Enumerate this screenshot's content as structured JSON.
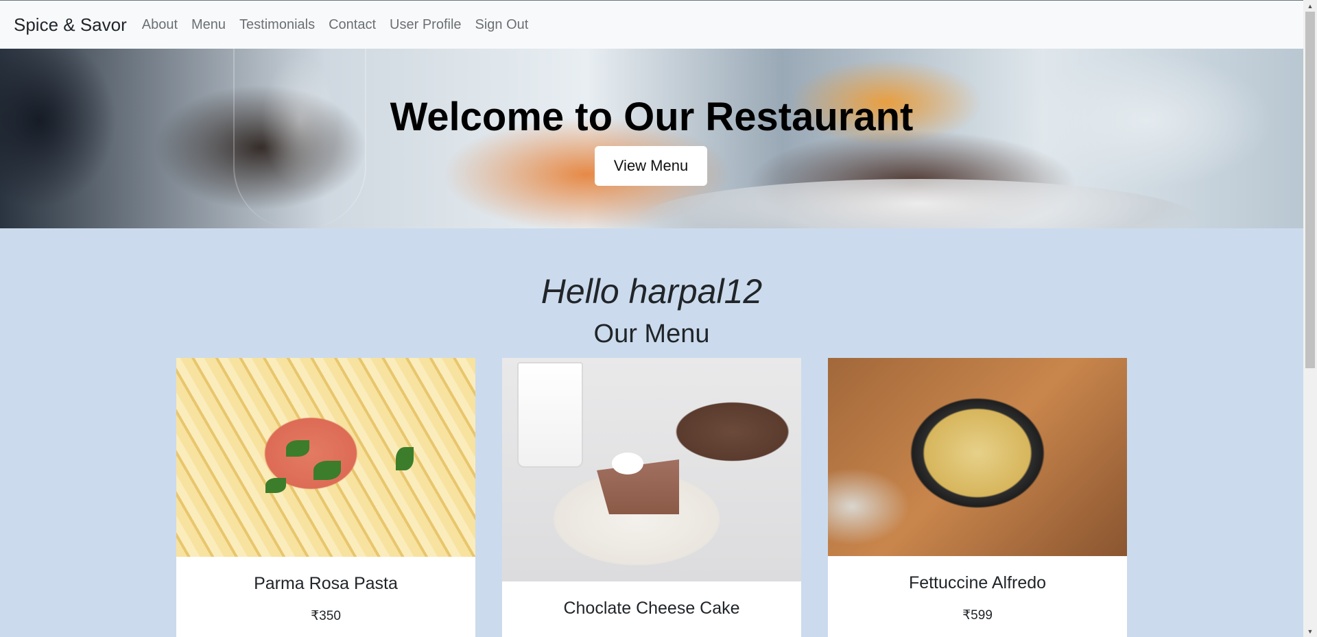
{
  "navbar": {
    "brand": "Spice & Savor",
    "links": [
      "About",
      "Menu",
      "Testimonials",
      "Contact",
      "User Profile",
      "Sign Out"
    ]
  },
  "hero": {
    "title": "Welcome to Our Restaurant",
    "button_label": "View Menu"
  },
  "greeting": "Hello harpal12",
  "menu": {
    "title": "Our Menu",
    "items": [
      {
        "name": "Parma Rosa Pasta",
        "price": "₹350"
      },
      {
        "name": "Choclate Cheese Cake",
        "price": ""
      },
      {
        "name": "Fettuccine Alfredo",
        "price": "₹599"
      }
    ]
  },
  "icons": {
    "scroll_up": "scroll-up-arrow-icon",
    "scroll_down": "scroll-down-arrow-icon"
  }
}
